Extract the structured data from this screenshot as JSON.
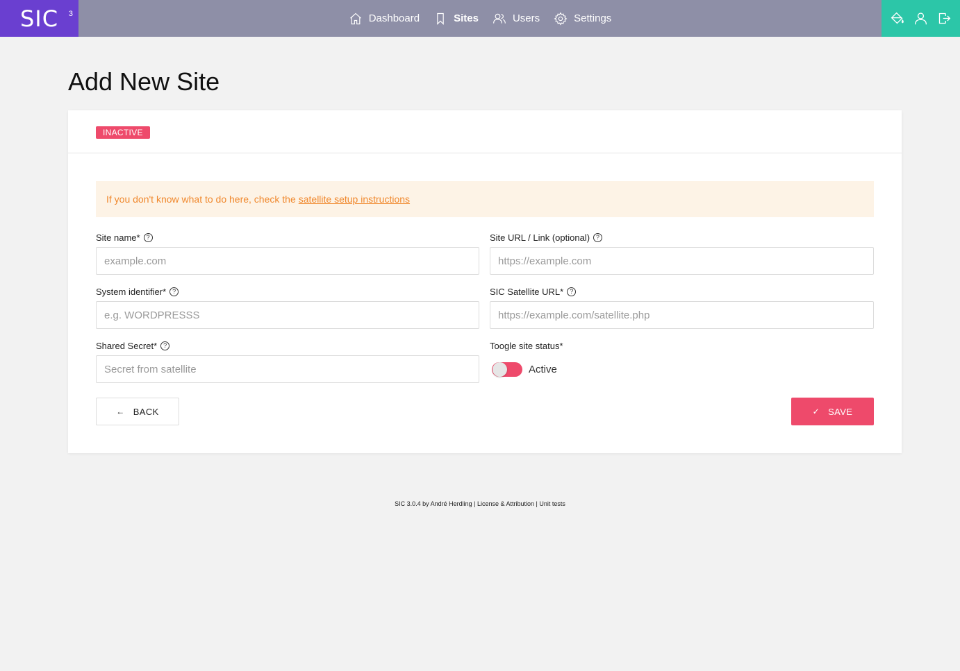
{
  "app": {
    "logo_text": "SIC",
    "logo_sub": "3"
  },
  "nav": {
    "items": [
      {
        "label": "Dashboard",
        "icon": "home-icon"
      },
      {
        "label": "Sites",
        "icon": "bookmark-icon",
        "active": true
      },
      {
        "label": "Users",
        "icon": "users-icon"
      },
      {
        "label": "Settings",
        "icon": "gear-icon"
      }
    ]
  },
  "tools": [
    "paint-bucket-icon",
    "user-icon",
    "logout-icon"
  ],
  "page": {
    "title": "Add New Site"
  },
  "status_badge": "INACTIVE",
  "notice": {
    "text": "If you don't know what to do here, check the",
    "link": "satellite setup instructions"
  },
  "form": {
    "site_name": {
      "label": "Site name*",
      "placeholder": "example.com",
      "value": ""
    },
    "site_url": {
      "label": "Site URL / Link (optional)",
      "placeholder": "https://example.com",
      "value": ""
    },
    "system_identifier": {
      "label": "System identifier*",
      "placeholder": "e.g. WORDPRESSS",
      "value": ""
    },
    "satellite_url": {
      "label": "SIC Satellite URL*",
      "placeholder": "https://example.com/satellite.php",
      "value": ""
    },
    "shared_secret": {
      "label": "Shared Secret*",
      "placeholder": "Secret from satellite",
      "value": ""
    },
    "status_toggle": {
      "label": "Toogle site status*",
      "state_label": "Active",
      "on": true
    }
  },
  "buttons": {
    "back": "BACK",
    "save": "SAVE"
  },
  "footer": {
    "prefix": "SIC 3.0.4 by André Herdling | ",
    "license": "License & Attribution",
    "separator": " | ",
    "tests": "Unit tests"
  },
  "colors": {
    "topbar": "#8e8fa7",
    "logo_bg": "#6a3fd0",
    "tools_bg": "#2cc6a8",
    "accent": "#ee4a6b",
    "notice_bg": "#fdf3e6",
    "notice_text": "#f0882d"
  }
}
